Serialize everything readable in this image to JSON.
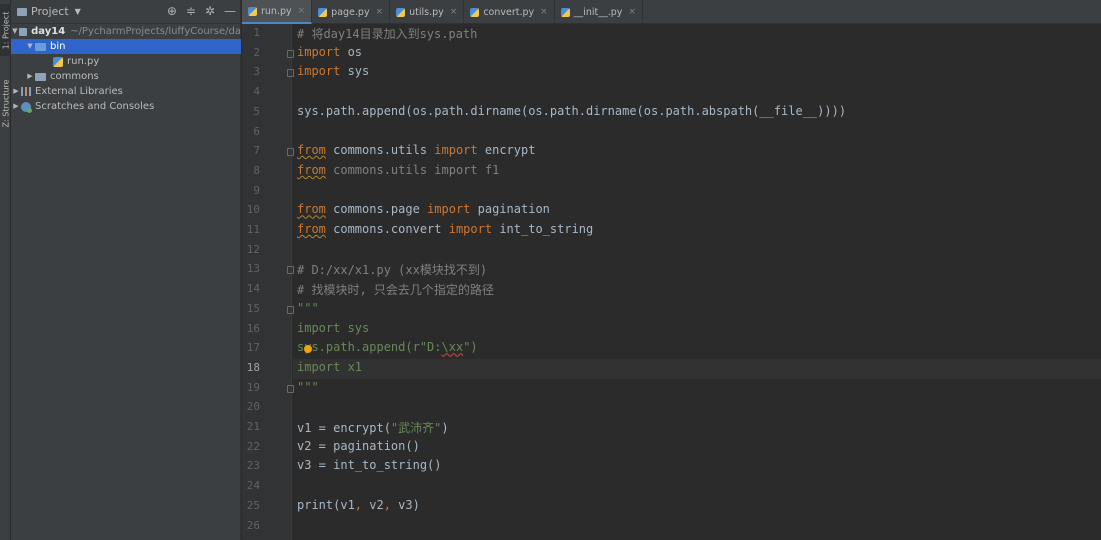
{
  "left_strip": {
    "project_tab": "1: Project",
    "structure_tab": "Z: Structure"
  },
  "project_panel": {
    "title": "Project",
    "tree": [
      {
        "label": "day14",
        "path": "~/PycharmProjects/luffyCourse/da",
        "kind": "root",
        "expanded": true
      },
      {
        "label": "bin",
        "kind": "folder",
        "expanded": true,
        "selected": true
      },
      {
        "label": "run.py",
        "kind": "python-file"
      },
      {
        "label": "commons",
        "kind": "folder",
        "expanded": false
      },
      {
        "label": "External Libraries",
        "kind": "library"
      },
      {
        "label": "Scratches and Consoles",
        "kind": "scratches"
      }
    ]
  },
  "tabs": [
    {
      "label": "run.py",
      "active": true
    },
    {
      "label": "page.py",
      "active": false
    },
    {
      "label": "utils.py",
      "active": false
    },
    {
      "label": "convert.py",
      "active": false
    },
    {
      "label": "__init__.py",
      "active": false
    }
  ],
  "editor": {
    "current_line": 18,
    "lines": [
      "# 将day14目录加入到sys.path",
      "import os",
      "import sys",
      "",
      "sys.path.append(os.path.dirname(os.path.dirname(os.path.abspath(__file__))))",
      "",
      "from commons.utils import encrypt",
      "from commons.utils import f1",
      "",
      "from commons.page import pagination",
      "from commons.convert import int_to_string",
      "",
      "# D:/xx/x1.py (xx模块找不到)",
      "# 找模块时, 只会去几个指定的路径",
      "\"\"\"",
      "import sys",
      "sys.path.append(r\"D:\\xx\")",
      "import x1",
      "\"\"\"",
      "",
      "v1 = encrypt(\"武沛齐\")",
      "v2 = pagination()",
      "v3 = int_to_string()",
      "",
      "print(v1, v2, v3)",
      ""
    ]
  },
  "colors": {
    "keyword": "#cc7832",
    "string": "#6a8759",
    "comment": "#808080",
    "selection": "#2f65ca"
  }
}
